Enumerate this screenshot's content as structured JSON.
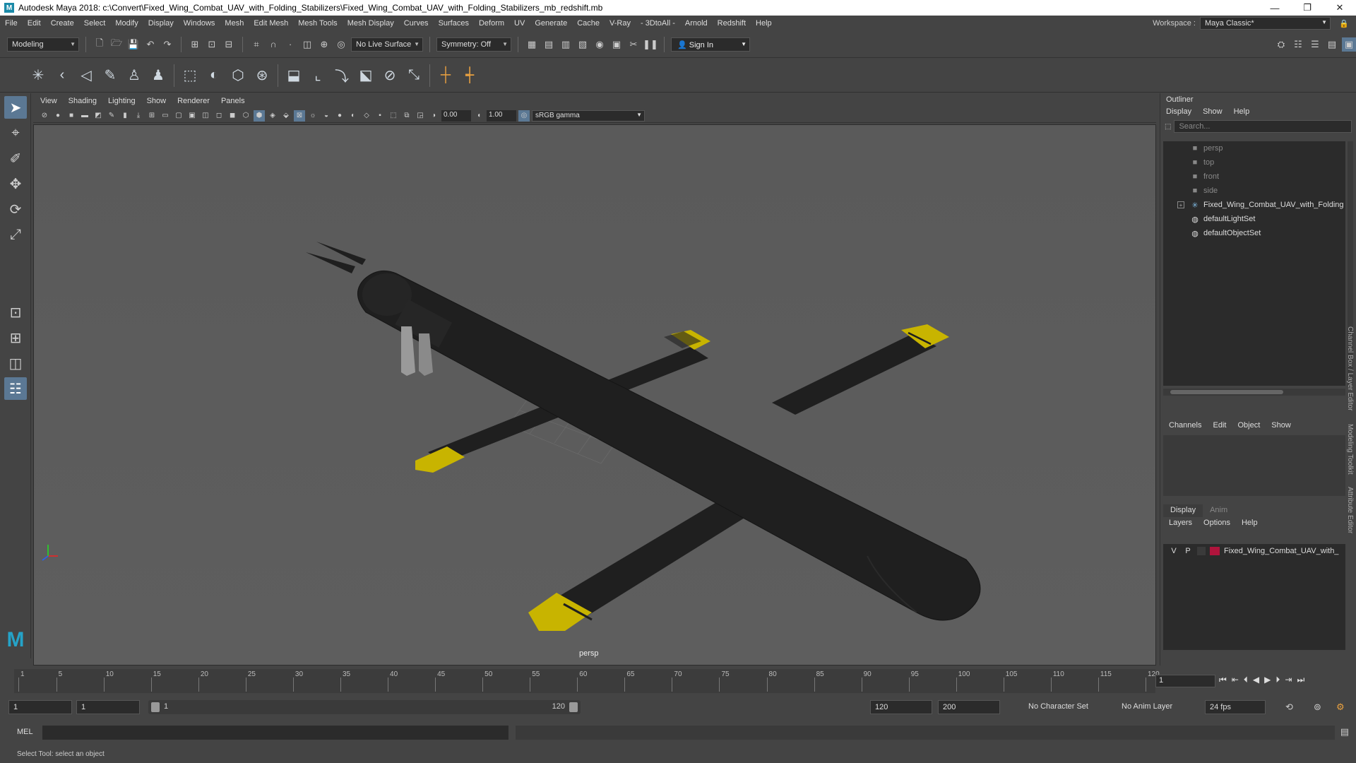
{
  "window": {
    "title": "Autodesk Maya 2018: c:\\Convert\\Fixed_Wing_Combat_UAV_with_Folding_Stabilizers\\Fixed_Wing_Combat_UAV_with_Folding_Stabilizers_mb_redshift.mb",
    "app_icon": "M"
  },
  "menubar": {
    "items": [
      "File",
      "Edit",
      "Create",
      "Select",
      "Modify",
      "Display",
      "Windows",
      "Mesh",
      "Edit Mesh",
      "Mesh Tools",
      "Mesh Display",
      "Curves",
      "Surfaces",
      "Deform",
      "UV",
      "Generate",
      "Cache",
      "V-Ray",
      "- 3DtoAll -",
      "Arnold",
      "Redshift",
      "Help"
    ],
    "workspace_label": "Workspace :",
    "workspace_value": "Maya Classic*"
  },
  "statusline": {
    "mode": "Modeling",
    "live_surface": "No Live Surface",
    "symmetry": "Symmetry: Off",
    "sign_in": "Sign In"
  },
  "viewport": {
    "menu": [
      "View",
      "Shading",
      "Lighting",
      "Show",
      "Renderer",
      "Panels"
    ],
    "exposure": "0.00",
    "gamma": "1.00",
    "color_space": "sRGB gamma",
    "camera": "persp"
  },
  "outliner": {
    "title": "Outliner",
    "menu": [
      "Display",
      "Show",
      "Help"
    ],
    "search_placeholder": "Search...",
    "items": [
      {
        "label": "persp",
        "dim": true,
        "icon": "camera-icon"
      },
      {
        "label": "top",
        "dim": true,
        "icon": "camera-icon"
      },
      {
        "label": "front",
        "dim": true,
        "icon": "camera-icon"
      },
      {
        "label": "side",
        "dim": true,
        "icon": "camera-icon"
      },
      {
        "label": "Fixed_Wing_Combat_UAV_with_Folding",
        "dim": false,
        "icon": "group-icon"
      },
      {
        "label": "defaultLightSet",
        "dim": false,
        "icon": "set-icon"
      },
      {
        "label": "defaultObjectSet",
        "dim": false,
        "icon": "set-icon"
      }
    ]
  },
  "channelbox": {
    "menu": [
      "Channels",
      "Edit",
      "Object",
      "Show"
    ]
  },
  "layereditor": {
    "tabs": [
      "Display",
      "Anim"
    ],
    "menu": [
      "Layers",
      "Options",
      "Help"
    ],
    "layer": {
      "v": "V",
      "p": "P",
      "name": "Fixed_Wing_Combat_UAV_with_",
      "color": "#b0143c"
    }
  },
  "side_tabs": [
    "Channel Box / Layer Editor",
    "Modeling Toolkit",
    "Attribute Editor"
  ],
  "timeslider": {
    "ticks": [
      "1",
      "5",
      "10",
      "15",
      "20",
      "25",
      "30",
      "35",
      "40",
      "45",
      "50",
      "55",
      "60",
      "65",
      "70",
      "75",
      "80",
      "85",
      "90",
      "95",
      "100",
      "105",
      "110",
      "115",
      "120"
    ],
    "current_frame": "1"
  },
  "rangeslider": {
    "start": "1",
    "start_inner": "1",
    "range_start_label": "1",
    "range_end_label": "120",
    "end_inner": "120",
    "end": "200",
    "character_set": "No Character Set",
    "anim_layer": "No Anim Layer",
    "fps": "24 fps"
  },
  "cmdline": {
    "label": "MEL"
  },
  "helpline": {
    "text": "Select Tool: select an object"
  },
  "colors": {
    "uav_body": "#1f1f1f",
    "wing_tip": "#c8b400",
    "layer_color": "#b0143c"
  }
}
